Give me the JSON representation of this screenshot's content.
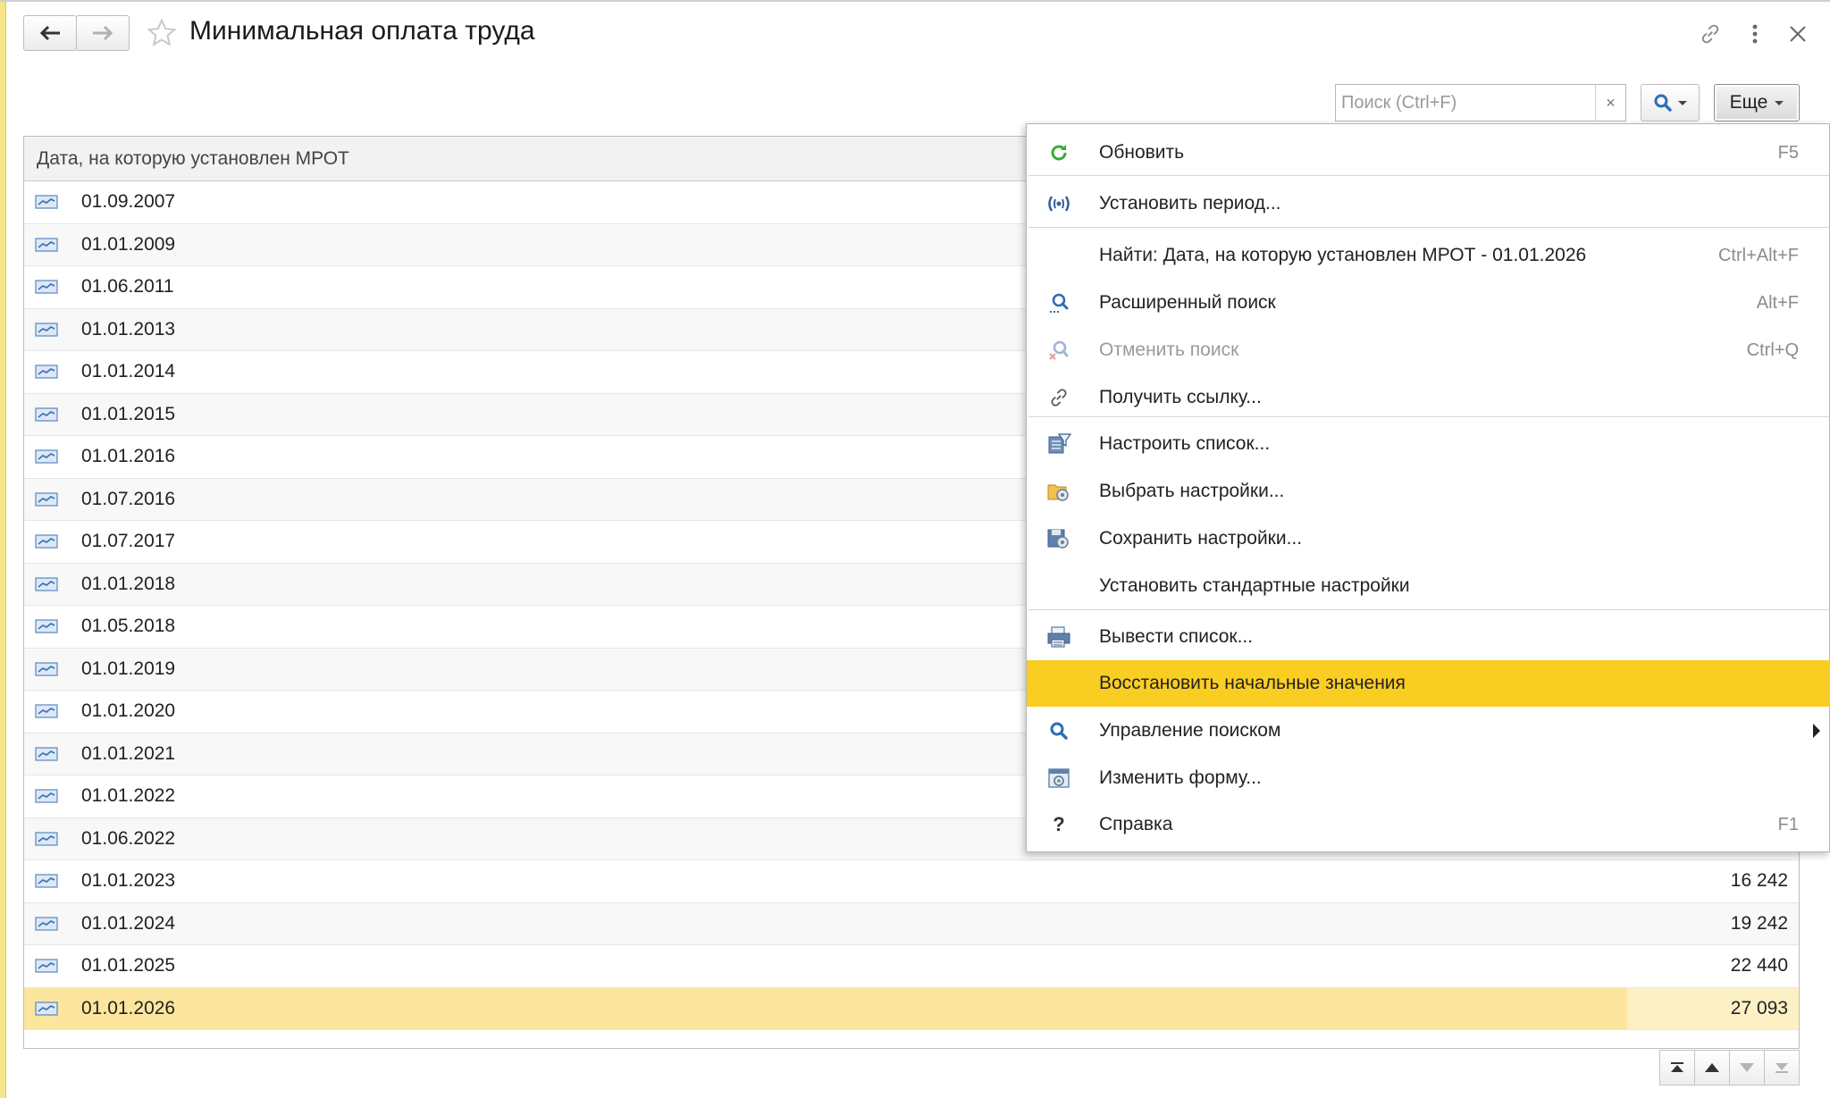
{
  "window": {
    "title": "Минимальная оплата труда"
  },
  "toolbar": {
    "search_placeholder": "Поиск (Ctrl+F)",
    "search_clear": "×",
    "more_label": "Еще"
  },
  "table": {
    "column_header": "Дата, на которую установлен МРОТ",
    "rows": [
      {
        "date": "01.09.2007",
        "value": ""
      },
      {
        "date": "01.01.2009",
        "value": ""
      },
      {
        "date": "01.06.2011",
        "value": ""
      },
      {
        "date": "01.01.2013",
        "value": ""
      },
      {
        "date": "01.01.2014",
        "value": ""
      },
      {
        "date": "01.01.2015",
        "value": ""
      },
      {
        "date": "01.01.2016",
        "value": ""
      },
      {
        "date": "01.07.2016",
        "value": ""
      },
      {
        "date": "01.07.2017",
        "value": ""
      },
      {
        "date": "01.01.2018",
        "value": ""
      },
      {
        "date": "01.05.2018",
        "value": ""
      },
      {
        "date": "01.01.2019",
        "value": ""
      },
      {
        "date": "01.01.2020",
        "value": ""
      },
      {
        "date": "01.01.2021",
        "value": ""
      },
      {
        "date": "01.01.2022",
        "value": ""
      },
      {
        "date": "01.06.2022",
        "value": ""
      },
      {
        "date": "01.01.2023",
        "value": "16 242"
      },
      {
        "date": "01.01.2024",
        "value": "19 242"
      },
      {
        "date": "01.01.2025",
        "value": "22 440"
      },
      {
        "date": "01.01.2026",
        "value": "27 093"
      }
    ],
    "selected_row_index": 19
  },
  "menu": {
    "items": [
      {
        "label": "Обновить",
        "shortcut": "F5",
        "icon": "refresh-icon"
      },
      {
        "label": "Установить период...",
        "shortcut": "",
        "icon": "period-icon"
      },
      {
        "label": "Найти: Дата, на которую установлен МРОТ - 01.01.2026",
        "shortcut": "Ctrl+Alt+F",
        "icon": ""
      },
      {
        "label": "Расширенный поиск",
        "shortcut": "Alt+F",
        "icon": "advanced-search-icon"
      },
      {
        "label": "Отменить поиск",
        "shortcut": "Ctrl+Q",
        "icon": "cancel-search-icon",
        "disabled": true
      },
      {
        "label": "Получить ссылку...",
        "shortcut": "",
        "icon": "link-icon"
      },
      {
        "label": "Настроить список...",
        "shortcut": "",
        "icon": "list-settings-icon"
      },
      {
        "label": "Выбрать настройки...",
        "shortcut": "",
        "icon": "choose-settings-icon"
      },
      {
        "label": "Сохранить настройки...",
        "shortcut": "",
        "icon": "save-settings-icon"
      },
      {
        "label": "Установить стандартные настройки",
        "shortcut": "",
        "icon": ""
      },
      {
        "label": "Вывести список...",
        "shortcut": "",
        "icon": "print-list-icon"
      },
      {
        "label": "Восстановить начальные значения",
        "shortcut": "",
        "icon": "",
        "highlighted": true
      },
      {
        "label": "Управление поиском",
        "shortcut": "",
        "icon": "search-icon",
        "submenu": true
      },
      {
        "label": "Изменить форму...",
        "shortcut": "",
        "icon": "form-icon"
      },
      {
        "label": "Справка",
        "shortcut": "F1",
        "icon": "help-icon"
      }
    ]
  },
  "colors": {
    "highlight": "#f9cd22",
    "selected_row": "#fce69e",
    "refresh_icon": "#3aaa35",
    "accent_blue": "#3a6fb0"
  }
}
